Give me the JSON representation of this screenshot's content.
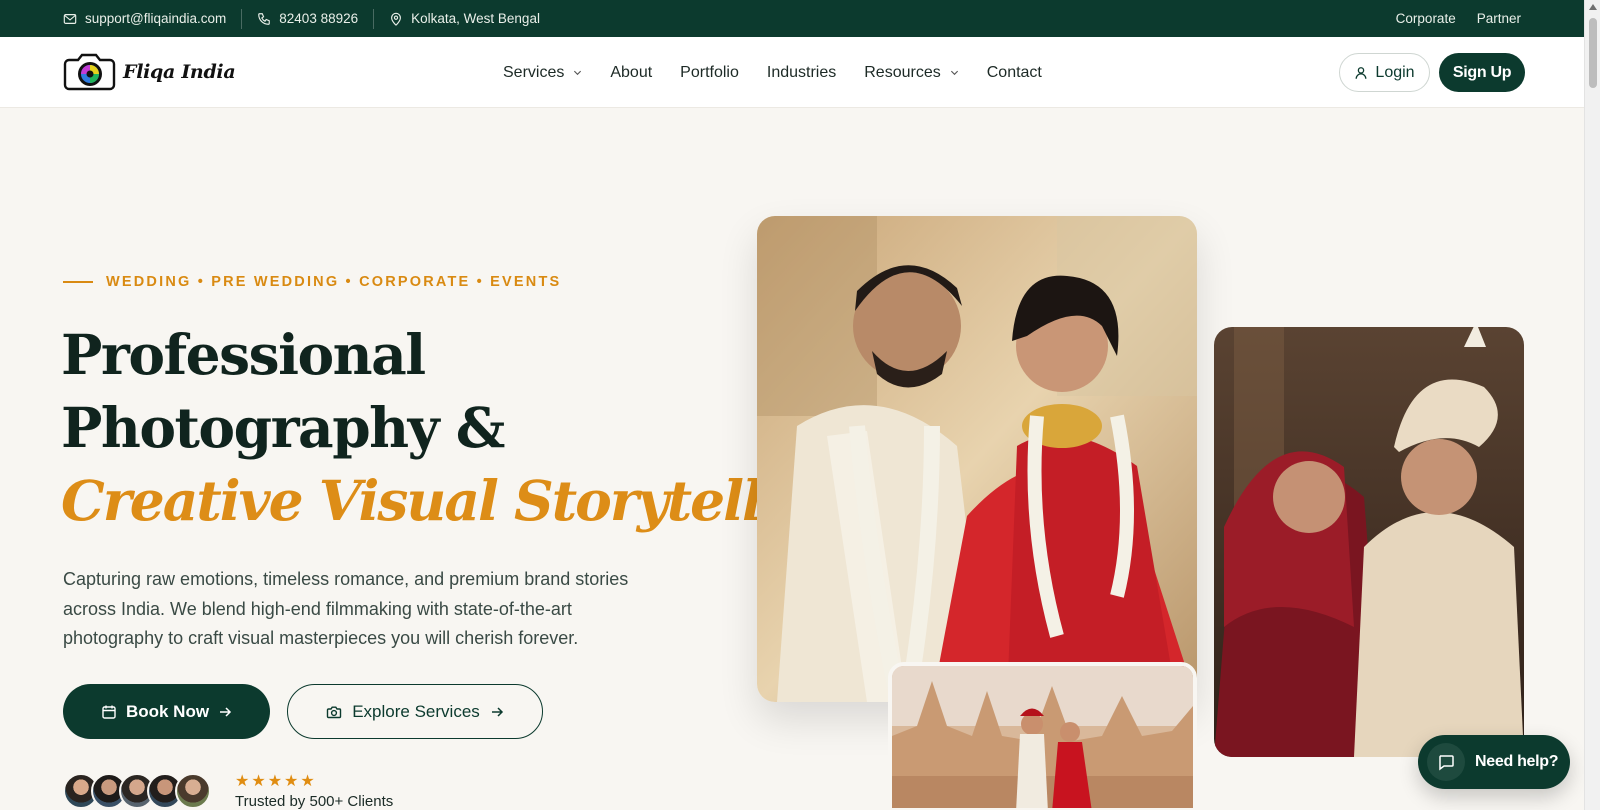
{
  "topbar": {
    "email": "support@fliqaindia.com",
    "phone": "82403 88926",
    "location": "Kolkata, West Bengal",
    "links": [
      "Corporate",
      "Partner"
    ]
  },
  "header": {
    "logo_text": "Fliqa India",
    "nav": [
      {
        "label": "Services",
        "dropdown": true
      },
      {
        "label": "About",
        "dropdown": false
      },
      {
        "label": "Portfolio",
        "dropdown": false
      },
      {
        "label": "Industries",
        "dropdown": false
      },
      {
        "label": "Resources",
        "dropdown": true
      },
      {
        "label": "Contact",
        "dropdown": false
      }
    ],
    "login_label": "Login",
    "signup_label": "Sign Up"
  },
  "hero": {
    "eyebrow": "WEDDING • PRE WEDDING • CORPORATE • EVENTS",
    "title_line1": "Professional",
    "title_line2": "Photography &",
    "title_line3": "Creative Visual Storytelling",
    "lead": "Capturing raw emotions, timeless romance, and premium brand stories across India. We blend high-end filmmaking with state-of-the-art photography to craft visual masterpieces you will cherish forever.",
    "book_label": "Book Now",
    "explore_label": "Explore Services",
    "stars": "★★★★★",
    "trusted": "Trusted by 500+ Clients"
  },
  "chat": {
    "label": "Need help?"
  },
  "colors": {
    "brand": "#0c3a2e",
    "accent": "#dd8d17",
    "background": "#f8f6f2"
  }
}
